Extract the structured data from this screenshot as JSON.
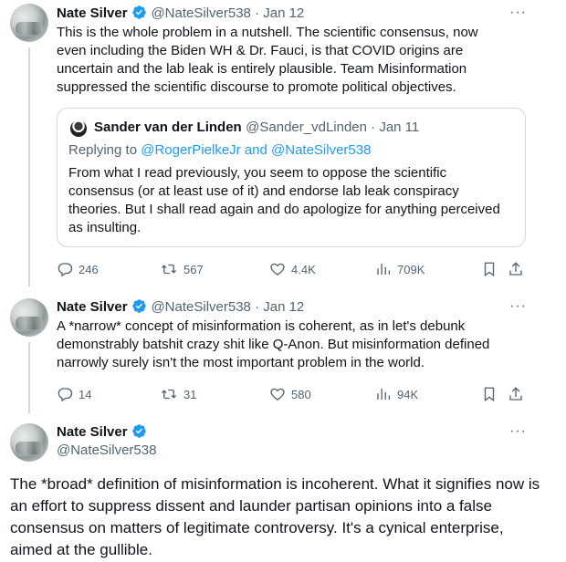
{
  "tweet1": {
    "name": "Nate Silver",
    "handle_date": "@NateSilver538 · Jan 12",
    "more": "···",
    "text": "This is the whole problem in a nutshell. The scientific consensus, now even including the Biden WH & Dr. Fauci, is that COVID origins are uncertain and the lab leak is entirely plausible. Team Misinformation suppressed the scientific discourse to promote political objectives.",
    "quote": {
      "name": "Sander van der Linden",
      "handle_date": "@Sander_vdLinden · Jan 11",
      "replying_prefix": "Replying to ",
      "replying_to": "@RogerPielkeJr and @NateSilver538",
      "text": "From what I read previously, you seem to oppose the scientific consensus (or at least use of it) and endorse lab leak conspiracy theories. But I shall read again and do apologize for anything perceived as insulting."
    },
    "actions": {
      "replies": "246",
      "retweets": "567",
      "likes": "4.4K",
      "views": "709K"
    }
  },
  "tweet2": {
    "name": "Nate Silver",
    "handle_date": "@NateSilver538 · Jan 12",
    "more": "···",
    "text": "A *narrow* concept of misinformation is coherent, as in let's debunk demonstrably batshit crazy shit like Q-Anon. But misinformation defined narrowly surely isn't the most important problem in the world.",
    "actions": {
      "replies": "14",
      "retweets": "31",
      "likes": "580",
      "views": "94K"
    }
  },
  "tweet3": {
    "name": "Nate Silver",
    "handle": "@NateSilver538",
    "more": "···",
    "text": "The *broad* definition of misinformation is incoherent.  What it signifies now is an effort to suppress dissent and launder partisan opinions into a false consensus on matters of legitimate controversy. It's a cynical enterprise, aimed at the gullible."
  },
  "colors": {
    "text": "#0f1419",
    "muted": "#536471",
    "verified": "#1d9bf0",
    "border": "#cfd9de"
  }
}
